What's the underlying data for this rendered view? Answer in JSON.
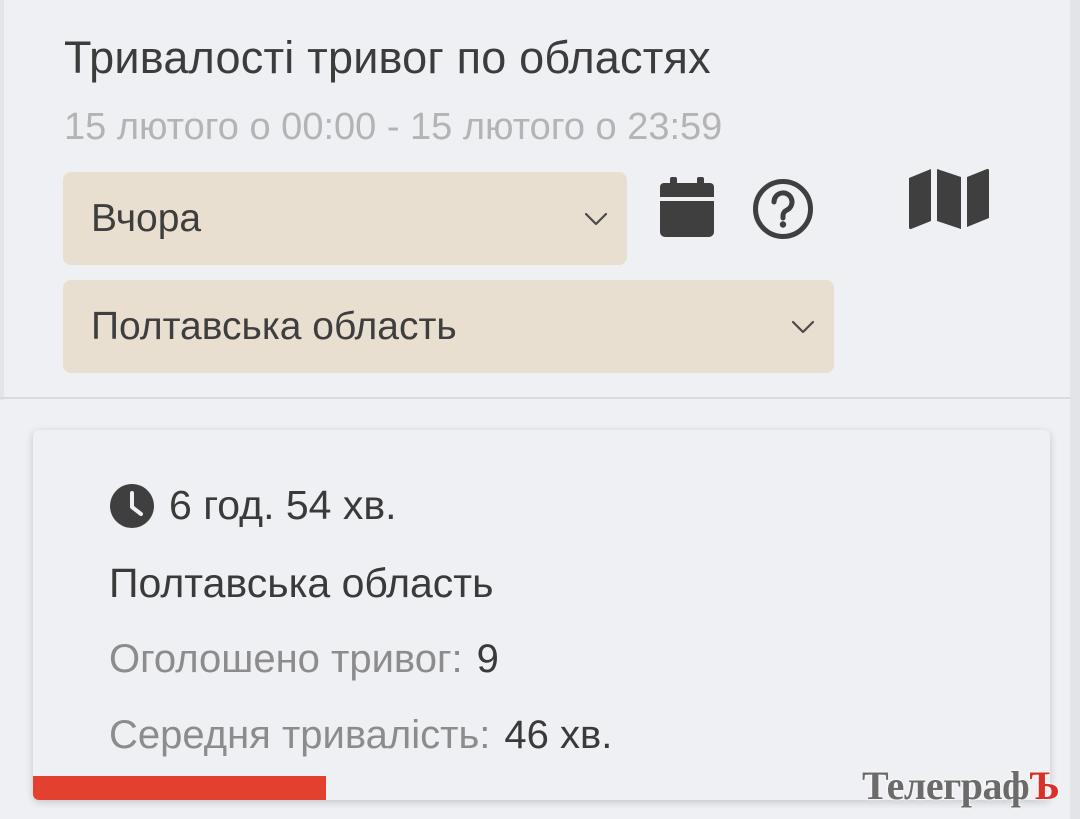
{
  "header": {
    "title": "Тривалості тривог по областях",
    "date_range": "15 лютого о 00:00 - 15 лютого о 23:59"
  },
  "filters": {
    "period": {
      "value": "Вчора",
      "icon": "chevron-down-icon"
    },
    "region": {
      "value": "Полтавська область",
      "icon": "chevron-down-icon"
    }
  },
  "toolbar": {
    "calendar_icon": "calendar-icon",
    "help_icon": "question-circle-icon",
    "map_icon": "map-icon"
  },
  "card": {
    "duration": "6 год. 54 хв.",
    "duration_icon": "clock-icon",
    "region": "Полтавська область",
    "alerts_label": "Оголошено тривог:",
    "alerts_value": "9",
    "avg_label": "Середня тривалість:",
    "avg_value": "46 хв.",
    "progress_fraction": 0.288
  },
  "watermark": {
    "main": "Телеграф",
    "accent": "Ъ"
  },
  "colors": {
    "background": "#eff0f3",
    "select_bg": "#e8dfd0",
    "bar_red": "#e4402f",
    "text_dark": "#3a3a3a",
    "text_muted": "#b4b4b4"
  }
}
